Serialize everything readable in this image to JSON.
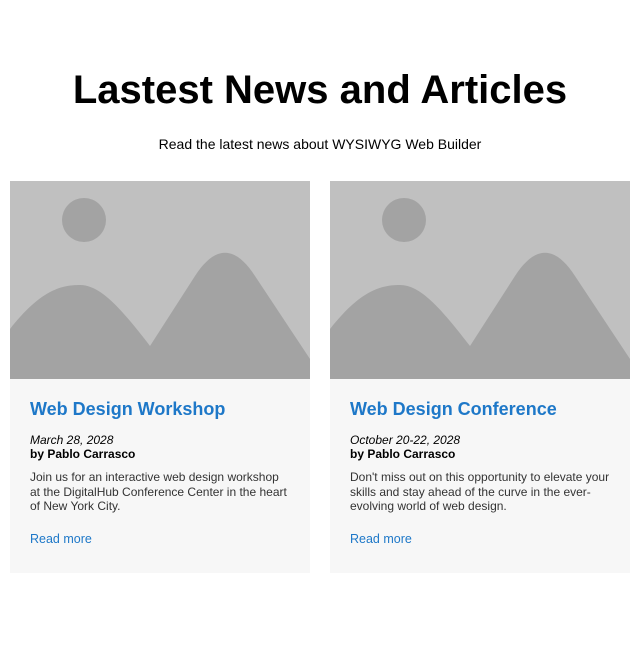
{
  "header": {
    "title": "Lastest News and Articles",
    "subtitle": "Read the latest news about WYSIWYG Web Builder"
  },
  "articles": [
    {
      "title": "Web Design Workshop",
      "date": "March 28, 2028",
      "author": "by Pablo Carrasco",
      "body": "Join us for an interactive web design workshop at the DigitalHub Conference Center in the heart of New York City.",
      "link": "Read more",
      "image_icon": "image-placeholder-icon"
    },
    {
      "title": "Web Design Conference",
      "date": "October 20-22, 2028",
      "author": "by Pablo Carrasco",
      "body": "Don't miss out on this opportunity to elevate your skills and stay ahead of the curve in the ever-evolving world of web design.",
      "link": "Read more",
      "image_icon": "image-placeholder-icon"
    }
  ],
  "colors": {
    "accent": "#1e78c8",
    "card_background": "#f7f7f7",
    "placeholder_light": "#c0c0c0",
    "placeholder_dark": "#a3a3a3"
  }
}
